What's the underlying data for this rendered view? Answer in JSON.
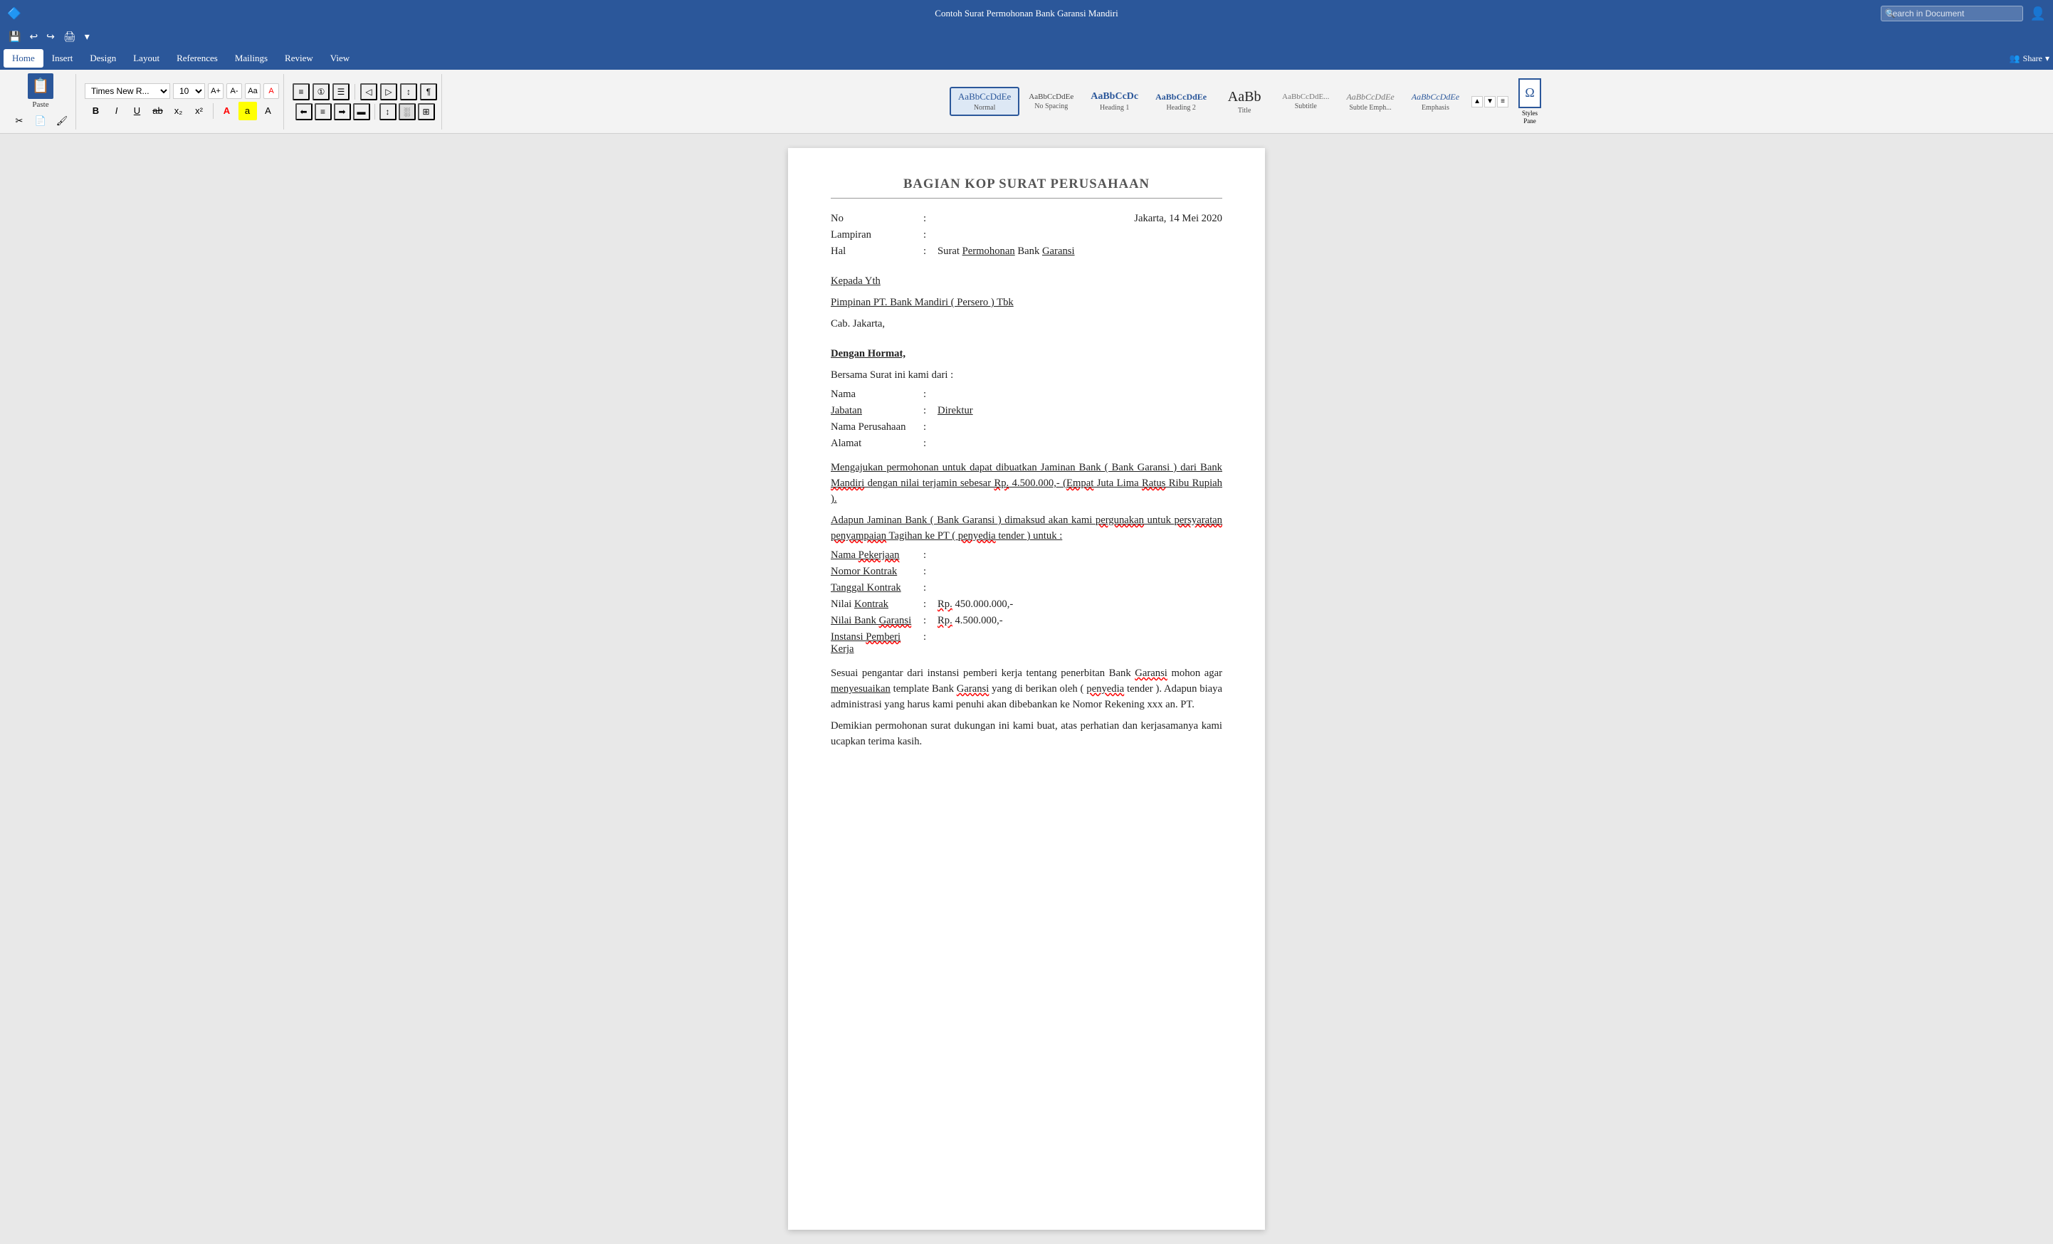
{
  "titleBar": {
    "title": "Contoh Surat Permohonan Bank Garansi Mandiri",
    "searchPlaceholder": "Search in Document",
    "shareLabel": "Share"
  },
  "quickAccess": {
    "buttons": [
      "💾",
      "↩",
      "↪",
      "🖨",
      "✏"
    ]
  },
  "menuBar": {
    "items": [
      "Home",
      "Insert",
      "Design",
      "Layout",
      "References",
      "Mailings",
      "Review",
      "View"
    ],
    "activeItem": "Home"
  },
  "ribbon": {
    "font": {
      "family": "Times New R...",
      "size": "10"
    },
    "styles": [
      {
        "id": "normal",
        "label": "Normal",
        "preview": "AaBbCcDdEe",
        "active": true
      },
      {
        "id": "no-spacing",
        "label": "No Spacing",
        "preview": "AaBbCcDdEe",
        "active": false
      },
      {
        "id": "heading1",
        "label": "Heading 1",
        "preview": "AaBbCcDc",
        "active": false
      },
      {
        "id": "heading2",
        "label": "Heading 2",
        "preview": "AaBbCcDdEe",
        "active": false
      },
      {
        "id": "title",
        "label": "Title",
        "preview": "AaBb",
        "active": false
      },
      {
        "id": "subtitle",
        "label": "Subtitle",
        "preview": "AaBbCcDdE...",
        "active": false
      },
      {
        "id": "subtle-emph",
        "label": "Subtle Emph...",
        "preview": "AaBbCcDdEe",
        "active": false
      },
      {
        "id": "emphasis",
        "label": "Emphasis",
        "preview": "AaBbCcDdEe",
        "active": false
      }
    ],
    "stylesPaneLabel": "Styles\nPane"
  },
  "document": {
    "headerTitle": "BAGIAN KOP SURAT PERUSAHAAN",
    "date": "Jakarta, 14 Mei 2020",
    "fields": [
      {
        "label": "No",
        "colon": ":",
        "value": ""
      },
      {
        "label": "Lampiran",
        "colon": ":",
        "value": ""
      },
      {
        "label": "Hal",
        "colon": ": Surat Permohonan Bank Garansi",
        "value": ""
      }
    ],
    "salutation": {
      "to": "Kepada Yth",
      "name": "Pimpinan PT. Bank Mandiri ( Persero ) Tbk",
      "address": "Cab. Jakarta,"
    },
    "opening": {
      "greeting": "Dengan Hormat,",
      "intro": "Bersama Surat ini kami dari :"
    },
    "senderFields": [
      {
        "label": "Nama",
        "colon": ":",
        "value": ""
      },
      {
        "label": "Jabatan",
        "colon": ":",
        "value": "Direktur"
      },
      {
        "label": "Nama Perusahaan",
        "colon": ":",
        "value": ""
      },
      {
        "label": "Alamat",
        "colon": ":",
        "value": ""
      }
    ],
    "paragraph1": "Mengajukan permohonan untuk dapat dibuatkan Jaminan Bank ( Bank Garansi ) dari Bank Mandiri dengan nilai terjamin sebesar Rp. 4.500.000,- (Empat Juta Lima Ratus Ribu Rupiah ).",
    "paragraph2": "Adapun Jaminan Bank ( Bank Garansi ) dimaksud akan kami pergunakan untuk persyaratan penyampaian Tagihan ke PT ( penyedia tender ) untuk :",
    "contractFields": [
      {
        "label": "Nama Pekerjaan",
        "colon": ":",
        "value": ""
      },
      {
        "label": "Nomor Kontrak",
        "colon": ":",
        "value": ""
      },
      {
        "label": "Tanggal Kontrak",
        "colon": ":",
        "value": ""
      },
      {
        "label": "Nilai Kontrak",
        "colon": ":",
        "value": "Rp. 450.000.000,-"
      },
      {
        "label": "Nilai Bank Garansi",
        "colon": ":",
        "value": "Rp. 4.500.000,-"
      },
      {
        "label": "Instansi Pemberi Kerja",
        "colon": ":",
        "value": ""
      }
    ],
    "paragraph3": "Sesuai pengantar dari instansi pemberi kerja tentang penerbitan Bank Garansi mohon agar menyesuaikan template Bank Garansi yang di berikan oleh ( penyedia tender ). Adapun biaya administrasi yang harus kami penuhi akan dibebankan ke Nomor Rekening xxx an. PT.",
    "paragraph4": "Demikian permohonan surat dukungan ini kami buat, atas perhatian dan kerjasamanya kami ucapkan terima kasih."
  }
}
